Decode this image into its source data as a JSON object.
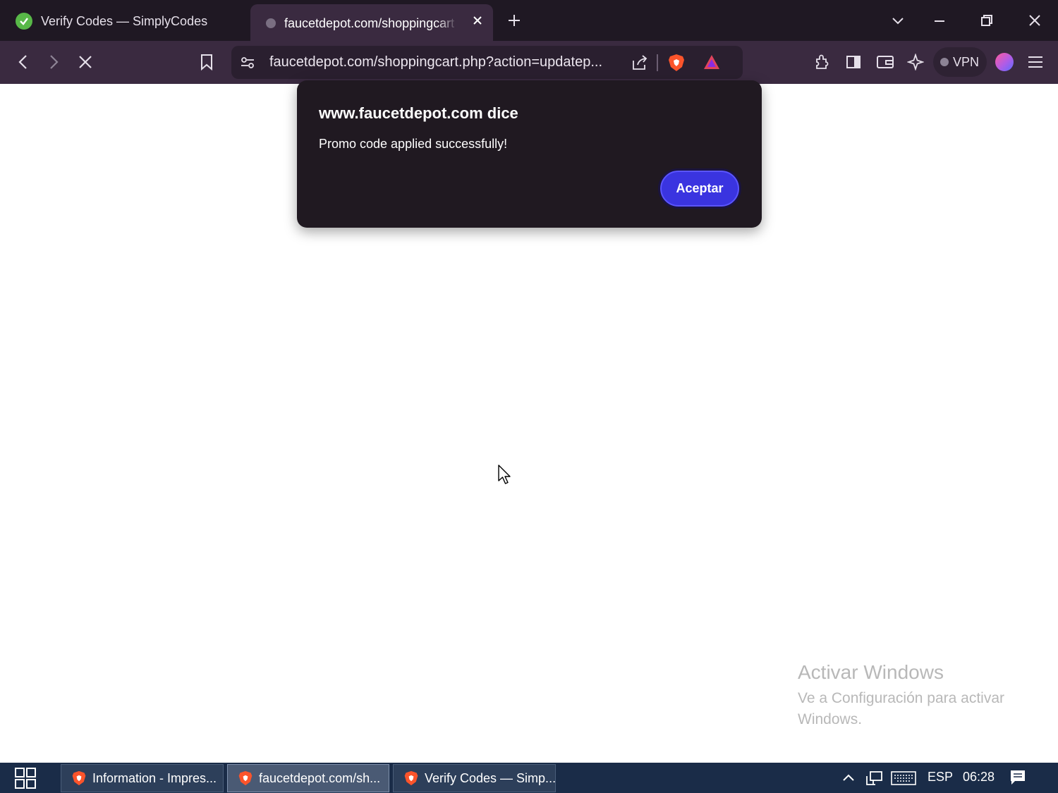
{
  "browser": {
    "tabs": [
      {
        "title": "Verify Codes — SimplyCodes",
        "active": false
      },
      {
        "title": "faucetdepot.com/shoppingcart",
        "active": true
      }
    ],
    "url": "faucetdepot.com/shoppingcart.php?action=updatep...",
    "vpn_label": "VPN"
  },
  "dialog": {
    "title": "www.faucetdepot.com dice",
    "message": "Promo code applied successfully!",
    "accept_label": "Aceptar"
  },
  "watermark": {
    "title": "Activar Windows",
    "subtitle": "Ve a Configuración para activar Windows."
  },
  "taskbar": {
    "items": [
      {
        "label": "Information - Impres..."
      },
      {
        "label": "faucetdepot.com/sh...",
        "active": true
      },
      {
        "label": "Verify Codes — Simp..."
      }
    ],
    "language": "ESP",
    "time": "06:28"
  },
  "colors": {
    "tabstrip": "#1f1823",
    "toolbar": "#3a2a40",
    "dialog_bg": "#201921",
    "accent_button": "#3a34e0",
    "taskbar": "#1a2c48"
  }
}
